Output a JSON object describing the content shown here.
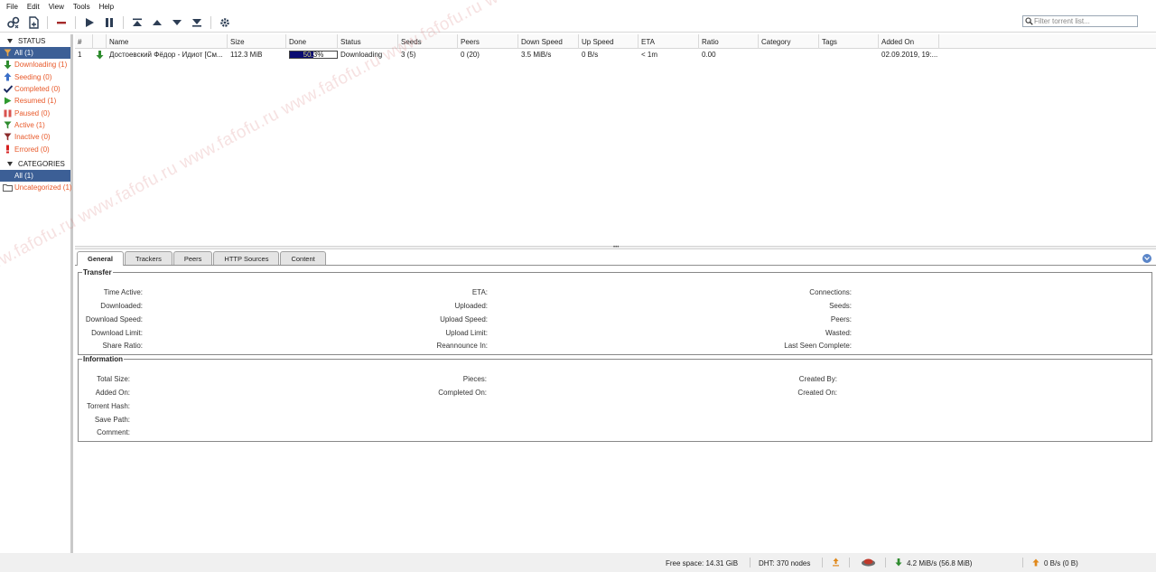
{
  "menu": [
    "File",
    "Edit",
    "View",
    "Tools",
    "Help"
  ],
  "toolbar": {
    "search_placeholder": "Filter torrent list..."
  },
  "sidebar": {
    "status_header": "STATUS",
    "status_items": [
      {
        "label": "All (1)",
        "icon": "filter-icon",
        "selected": true
      },
      {
        "label": "Downloading (1)",
        "icon": "download-arrow-icon"
      },
      {
        "label": "Seeding (0)",
        "icon": "upload-arrow-icon"
      },
      {
        "label": "Completed (0)",
        "icon": "checkmark-icon"
      },
      {
        "label": "Resumed (1)",
        "icon": "play-icon"
      },
      {
        "label": "Paused (0)",
        "icon": "pause-icon"
      },
      {
        "label": "Active (1)",
        "icon": "filter-active-icon"
      },
      {
        "label": "Inactive (0)",
        "icon": "filter-inactive-icon"
      },
      {
        "label": "Errored (0)",
        "icon": "error-icon"
      }
    ],
    "categories_header": "CATEGORIES",
    "category_items": [
      {
        "label": "All (1)",
        "selected": true
      },
      {
        "label": "Uncategorized (1)",
        "icon": "folder-icon"
      }
    ]
  },
  "torrent_list": {
    "columns": [
      "#",
      "",
      "Name",
      "Size",
      "Done",
      "Status",
      "Seeds",
      "Peers",
      "Down Speed",
      "Up Speed",
      "ETA",
      "Ratio",
      "Category",
      "Tags",
      "Added On"
    ],
    "rows": [
      {
        "num": "1",
        "name": "Достоевский Фёдор - Идиот [См...",
        "size": "112.3 MiB",
        "done": "50.3%",
        "done_fraction": 0.503,
        "status": "Downloading",
        "seeds": "3 (5)",
        "peers": "0 (20)",
        "down_speed": "3.5 MiB/s",
        "up_speed": "0 B/s",
        "eta": "< 1m",
        "ratio": "0.00",
        "category": "",
        "tags": "",
        "added_on": "02.09.2019, 19:..."
      }
    ]
  },
  "tabs": [
    "General",
    "Trackers",
    "Peers",
    "HTTP Sources",
    "Content"
  ],
  "transfer": {
    "legend": "Transfer",
    "col1": [
      "Time Active:",
      "Downloaded:",
      "Download Speed:",
      "Download Limit:",
      "Share Ratio:"
    ],
    "col2": [
      "ETA:",
      "Uploaded:",
      "Upload Speed:",
      "Upload Limit:",
      "Reannounce In:"
    ],
    "col3": [
      "Connections:",
      "Seeds:",
      "Peers:",
      "Wasted:",
      "Last Seen Complete:"
    ]
  },
  "information": {
    "legend": "Information",
    "col1": [
      "Total Size:",
      "Added On:",
      "Torrent Hash:",
      "Save Path:",
      "Comment:"
    ],
    "col2": [
      "Pieces:",
      "Completed On:"
    ],
    "col3": [
      "Created By:",
      "Created On:"
    ]
  },
  "statusbar": {
    "free_space": "Free space: 14.31 GiB",
    "dht": "DHT: 370 nodes",
    "download": "4.2 MiB/s (56.8 MiB)",
    "upload": "0 B/s (0 B)"
  },
  "watermark": "fafofu.ru www.fafofu.ru www.fafofu.ru www.fafofu.ru www.fafofu.ru www.fafofu.ru www.fafofu.ru www.fafofu.ru www.",
  "colors": {
    "selected_bg": "#3c5f96",
    "sidebar_text": "#e8592a",
    "progress_fill": "#0b0c72"
  }
}
